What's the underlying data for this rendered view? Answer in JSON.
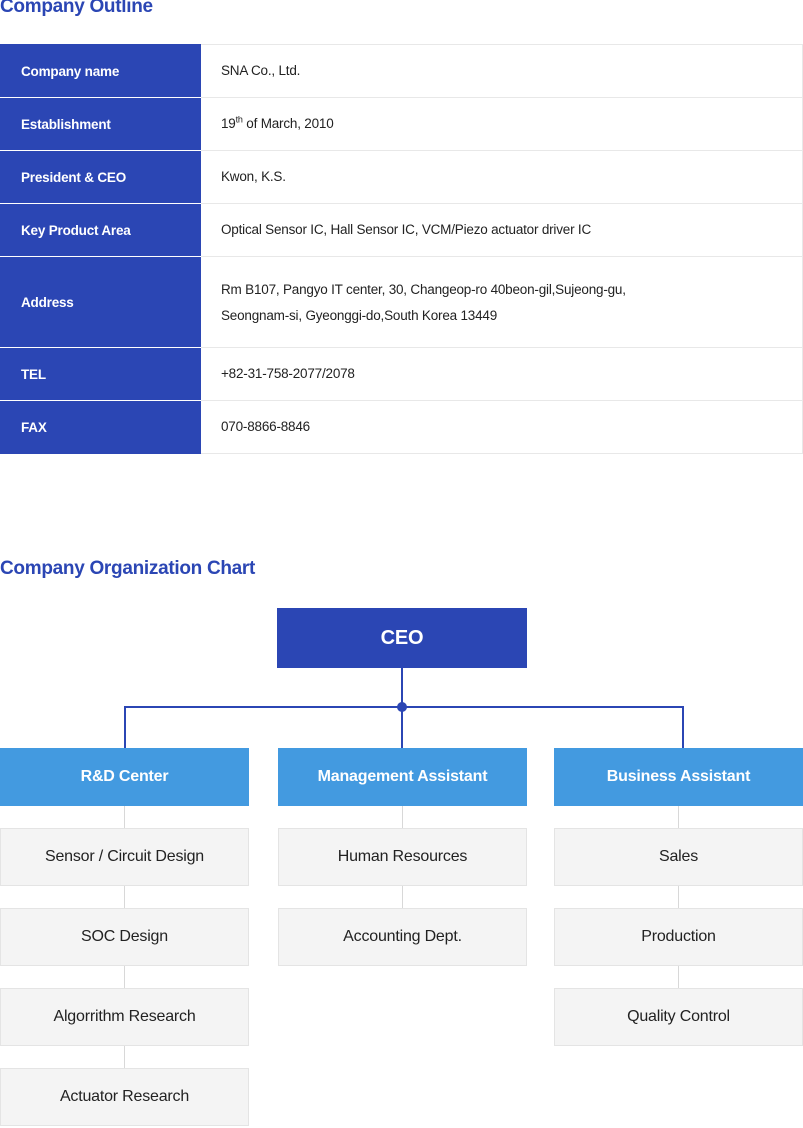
{
  "headings": {
    "outline": "Company Outline",
    "org": "Company Organization Chart"
  },
  "outline_table": {
    "rows": [
      {
        "label": "Company name",
        "value": "SNA Co., Ltd."
      },
      {
        "label": "Establishment",
        "value_prefix": "19",
        "value_sup": "th",
        "value_suffix": " of March, 2010"
      },
      {
        "label": "President & CEO",
        "value": "Kwon, K.S."
      },
      {
        "label": "Key Product Area",
        "value": "Optical Sensor IC, Hall Sensor IC, VCM/Piezo actuator driver IC"
      },
      {
        "label": "Address",
        "value_line1": "Rm B107, Pangyo IT center, 30, Changeop-ro 40beon-gil,Sujeong-gu,",
        "value_line2": "Seongnam-si, Gyeonggi-do,South Korea 13449"
      },
      {
        "label": "TEL",
        "value": "+82-31-758-2077/2078"
      },
      {
        "label": "FAX",
        "value": "070-8866-8846"
      }
    ]
  },
  "org_chart": {
    "ceo": "CEO",
    "departments": [
      {
        "name": "R&D Center",
        "children": [
          "Sensor / Circuit Design",
          "SOC Design",
          "Algorrithm Research",
          "Actuator Research"
        ]
      },
      {
        "name": "Management Assistant",
        "children": [
          "Human Resources",
          "Accounting Dept."
        ]
      },
      {
        "name": "Business Assistant",
        "children": [
          "Sales",
          "Production",
          "Quality Control"
        ]
      }
    ]
  },
  "colors": {
    "brand_dark_blue": "#2b46b4",
    "dept_blue": "#439ae0",
    "sub_gray": "#f4f4f4",
    "border_gray": "#e4e4e4"
  }
}
